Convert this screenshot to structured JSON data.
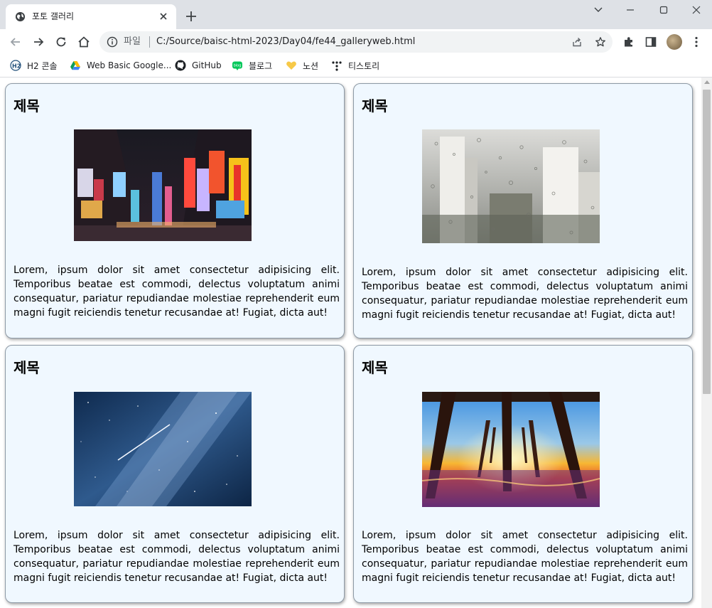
{
  "browser": {
    "tab_title": "포토 갤러리",
    "scheme_label": "파일",
    "url": "C:/Source/baisc-html-2023/Day04/fe44_galleryweb.html",
    "bookmarks": [
      {
        "label": "H2 콘솔",
        "icon": "h2-icon"
      },
      {
        "label": "Web Basic Google...",
        "icon": "google-drive-icon"
      },
      {
        "label": "GitHub",
        "icon": "github-icon"
      },
      {
        "label": "블로그",
        "icon": "blog-icon"
      },
      {
        "label": "노션",
        "icon": "heart-icon"
      },
      {
        "label": "티스토리",
        "icon": "tistory-icon"
      }
    ]
  },
  "gallery": {
    "cards": [
      {
        "title": "제목",
        "image": "times-square-night-photo",
        "text": "Lorem, ipsum dolor sit amet consectetur adipisicing elit. Temporibus beatae est commodi, delectus voluptatum animi consequatur, pariatur repudiandae molestiae reprehenderit eum magni fugit reiciendis tenetur recusandae at! Fugiat, dicta aut!"
      },
      {
        "title": "제목",
        "image": "rainy-window-city-photo",
        "text": "Lorem, ipsum dolor sit amet consectetur adipisicing elit. Temporibus beatae est commodi, delectus voluptatum animi consequatur, pariatur repudiandae molestiae reprehenderit eum magni fugit reiciendis tenetur recusandae at! Fugiat, dicta aut!"
      },
      {
        "title": "제목",
        "image": "milky-way-shooting-star-photo",
        "text": "Lorem, ipsum dolor sit amet consectetur adipisicing elit. Temporibus beatae est commodi, delectus voluptatum animi consequatur, pariatur repudiandae molestiae reprehenderit eum magni fugit reiciendis tenetur recusandae at! Fugiat, dicta aut!"
      },
      {
        "title": "제목",
        "image": "pier-sunset-photo",
        "text": "Lorem, ipsum dolor sit amet consectetur adipisicing elit. Temporibus beatae est commodi, delectus voluptatum animi consequatur, pariatur repudiandae molestiae reprehenderit eum magni fugit reiciendis tenetur recusandae at! Fugiat, dicta aut!"
      }
    ]
  },
  "colors": {
    "card_background": "#f0f8ff",
    "tabbar": "#dee1e6",
    "omnibox": "#f1f3f4"
  }
}
